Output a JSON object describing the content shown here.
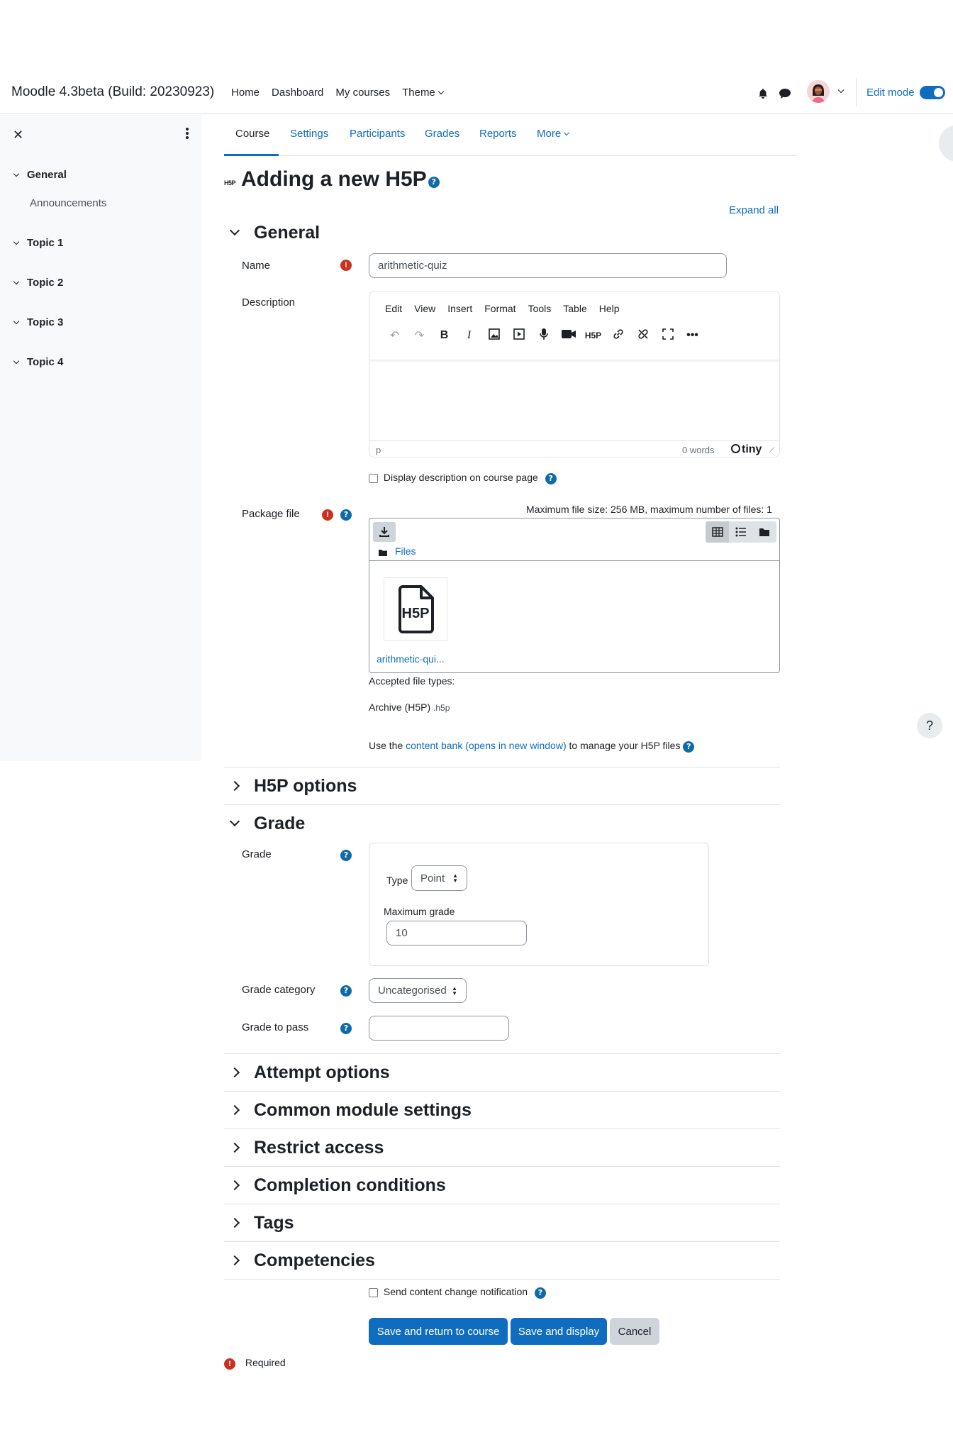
{
  "site": {
    "title": "Moodle 4.3beta (Build: 20230923)",
    "primary_nav": [
      "Home",
      "Dashboard",
      "My courses",
      "Theme"
    ],
    "edit_mode_label": "Edit mode"
  },
  "drawer": {
    "sections": [
      {
        "label": "General",
        "children": [
          "Announcements"
        ]
      },
      {
        "label": "Topic 1"
      },
      {
        "label": "Topic 2"
      },
      {
        "label": "Topic 3"
      },
      {
        "label": "Topic 4"
      }
    ]
  },
  "secondary_nav": [
    "Course",
    "Settings",
    "Participants",
    "Grades",
    "Reports",
    "More"
  ],
  "page": {
    "title": "Adding a new H5P",
    "expand_all": "Expand all",
    "h5p_badge": "H5P"
  },
  "general": {
    "header": "General",
    "name_label": "Name",
    "name_value": "arithmetic-quiz",
    "description_label": "Description",
    "editor_menu": [
      "Edit",
      "View",
      "Insert",
      "Format",
      "Tools",
      "Table",
      "Help"
    ],
    "editor_path": "p",
    "editor_words": "0 words",
    "editor_brand": "tiny",
    "display_desc_label": "Display description on course page",
    "package_label": "Package file",
    "max_size_text": "Maximum file size: 256 MB, maximum number of files: 1",
    "files_breadcrumb": "Files",
    "file_name": "arithmetic-qui...",
    "accepted_label": "Accepted file types:",
    "accepted_type": "Archive (H5P)",
    "accepted_ext": ".h5p",
    "content_bank_prefix": "Use the",
    "content_bank_link": "content bank (opens in new window)",
    "content_bank_suffix": "to manage your H5P files"
  },
  "sections": {
    "h5p_options": "H5P options",
    "grade": "Grade",
    "attempt_options": "Attempt options",
    "common_module": "Common module settings",
    "restrict_access": "Restrict access",
    "completion": "Completion conditions",
    "tags": "Tags",
    "competencies": "Competencies"
  },
  "grade": {
    "grade_label": "Grade",
    "type_label": "Type",
    "type_value": "Point",
    "max_grade_label": "Maximum grade",
    "max_grade_value": "10",
    "category_label": "Grade category",
    "category_value": "Uncategorised",
    "pass_label": "Grade to pass",
    "pass_value": ""
  },
  "footer": {
    "notify_label": "Send content change notification",
    "save_return": "Save and return to course",
    "save_display": "Save and display",
    "cancel": "Cancel",
    "required": "Required"
  },
  "floating_help": "?",
  "colors": {
    "primary": "#0f6cbf",
    "required": "#ca3120",
    "help": "#0f6ba8"
  }
}
